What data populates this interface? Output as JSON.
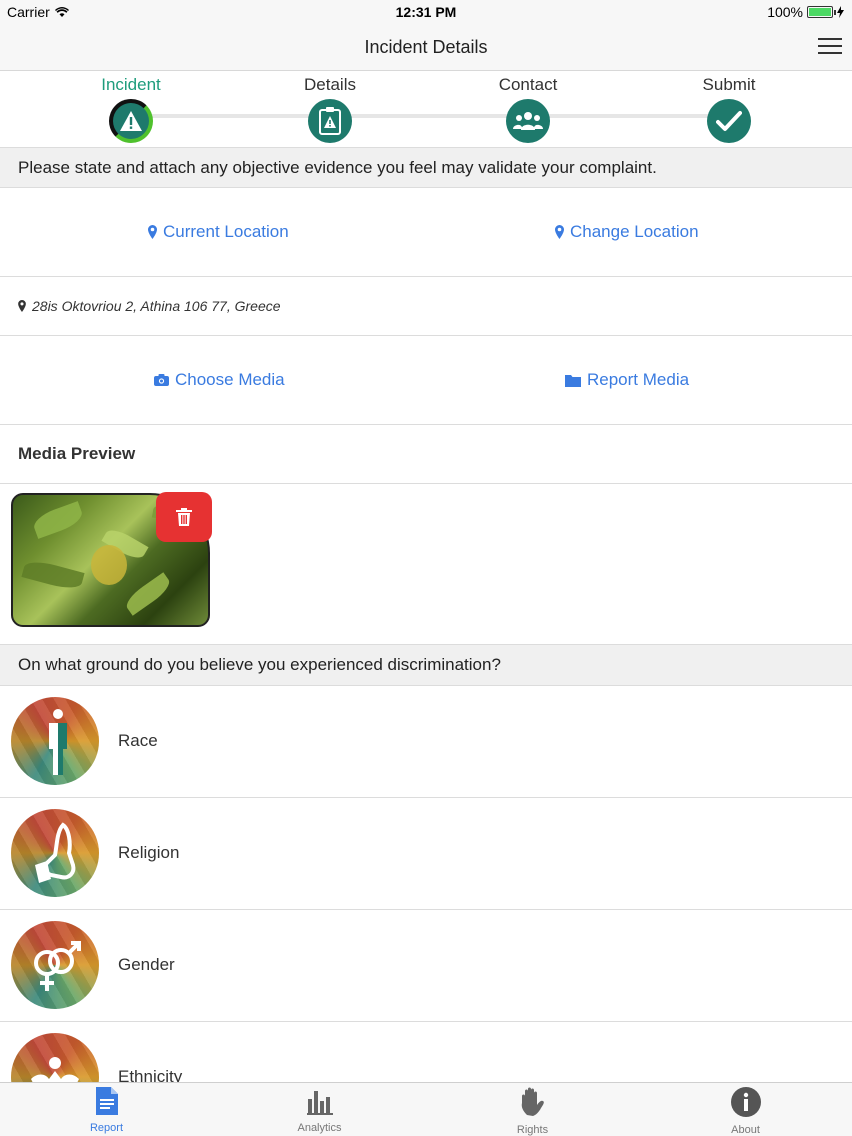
{
  "status_bar": {
    "carrier": "Carrier",
    "time": "12:31 PM",
    "battery": "100%"
  },
  "nav": {
    "title": "Incident Details"
  },
  "stepper": [
    {
      "label": "Incident",
      "active": true
    },
    {
      "label": "Details",
      "active": false
    },
    {
      "label": "Contact",
      "active": false
    },
    {
      "label": "Submit",
      "active": false
    }
  ],
  "evidence": {
    "prompt": "Please state and attach any objective evidence you feel may validate your complaint.",
    "current_location": "Current Location",
    "change_location": "Change Location",
    "address": "28is Oktovriou 2, Athina 106 77, Greece",
    "choose_media": "Choose Media",
    "report_media": "Report Media",
    "media_preview_title": "Media Preview"
  },
  "grounds": {
    "question": "On what ground do you believe you experienced discrimination?",
    "items": [
      {
        "label": "Race",
        "icon": "race-icon"
      },
      {
        "label": "Religion",
        "icon": "religion-icon"
      },
      {
        "label": "Gender",
        "icon": "gender-icon"
      },
      {
        "label": "Ethnicity",
        "icon": "ethnicity-icon"
      }
    ]
  },
  "tabbar": [
    {
      "label": "Report",
      "icon": "document-icon",
      "active": true
    },
    {
      "label": "Analytics",
      "icon": "bar-chart-icon",
      "active": false
    },
    {
      "label": "Rights",
      "icon": "hand-icon",
      "active": false
    },
    {
      "label": "About",
      "icon": "info-icon",
      "active": false
    }
  ],
  "colors": {
    "accent": "#3a7be0",
    "step_teal": "#1e7a6c",
    "active_step_text": "#1e9c7c",
    "delete_red": "#e63232"
  }
}
